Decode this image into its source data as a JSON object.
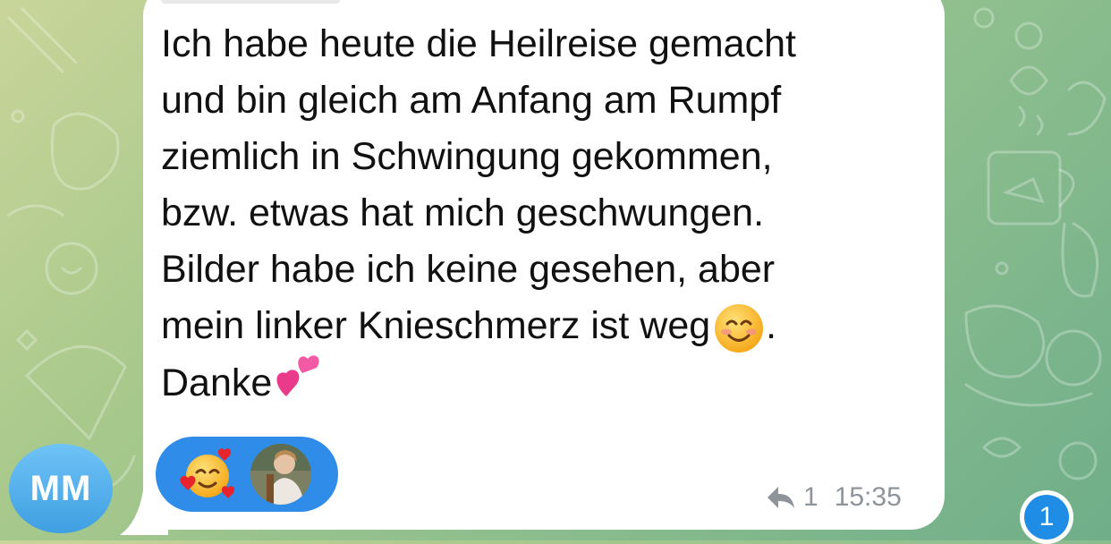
{
  "chat": {
    "sender_initials": "MM",
    "message_lines": [
      "Ich habe heute die Heilreise gemacht",
      "und bin gleich am Anfang am Rumpf",
      "ziemlich in Schwingung gekommen,",
      "bzw. etwas hat mich geschwungen.",
      "Bilder habe ich keine gesehen, aber",
      "mein linker Knieschmerz ist weg",
      "."
    ],
    "closing_word": "Danke",
    "reactions": [
      "smiling-face-with-hearts",
      "user-photo"
    ],
    "reply_count": "1",
    "time": "15:35",
    "unread_count": "1"
  },
  "colors": {
    "bubble": "#ffffff",
    "avatar": "#4aa8ec",
    "reaction_pill": "#2f8ce8",
    "meta_text": "#8e949a",
    "badge": "#1f8de6",
    "wallpaper": "#8fbf8e"
  },
  "icons": {
    "inline_emoji": "smiling-face-icon",
    "closing_emoji": "two-hearts-icon",
    "reply": "reply-arrow-icon"
  }
}
